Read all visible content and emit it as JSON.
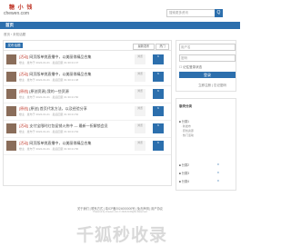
{
  "header": {
    "logo_cn": "糖 小 钱",
    "logo_en": "chewen.com",
    "search_placeholder": "搜索更多资讯",
    "search_btn": "Q"
  },
  "nav": {
    "home": "首页"
  },
  "breadcrumb": "首页 › 未知话题",
  "main": {
    "post_button": "发布话题",
    "sort_latest": "最新发布",
    "sort_hot": "热门",
    "rows": [
      {
        "tag": "[活动]",
        "title": "网页版单挑直播中，以美丽俏精品合集",
        "meta": "楼主 · 发布于 2024-01-01 · 最后回复 01:30:21:47",
        "views": "浏览",
        "replies": "6"
      },
      {
        "tag": "[活动]",
        "title": "网页版单挑直播中，以美丽俏精品合集",
        "meta": "楼主 · 发布于 2024-01-01 · 最后回复 01:30:21:48",
        "views": "浏览",
        "replies": "6"
      },
      {
        "tag": "[原创]",
        "title": "[原创资源] 我的一些资源",
        "meta": "楼主 · 发布于 2024-01-01 · 最后回复 01:30:21:50",
        "views": "浏览",
        "replies": "6"
      },
      {
        "tag": "[原创]",
        "title": "[原创] 首页代发方法，以及经验分享",
        "meta": "楼主 · 发布于 2024-01-01 · 最后回复 01:30:21:52",
        "views": "浏览",
        "replies": "6"
      },
      {
        "tag": "[活动]",
        "title": "支付宝限时红包促销火热中 — 最新一折解锁会员",
        "meta": "楼主 · 发布于 2024-01-01 · 最后回复 01:30:21:54",
        "views": "浏览",
        "replies": "6"
      },
      {
        "tag": "[活动]",
        "title": "网页版单挑直播中，以美丽俏精品合集",
        "meta": "楼主 · 发布于 2024-01-01 · 最后回复 01:30:21:56",
        "views": "浏览",
        "replies": "6"
      }
    ]
  },
  "sidebar": {
    "username_placeholder": "用户名",
    "password_placeholder": "密码",
    "remember": "☐ 记住登录状态",
    "login": "登录",
    "register": "立即注册 | 忘记密码",
    "categories_title": "版块分类",
    "cat1": "■ 分类1",
    "cat1_sub1": "· 新发布",
    "cat1_sub2": "· 原创资源",
    "cat1_sub3": "· 热门活动",
    "cat2": "■ 分类2",
    "cat2_count": "0",
    "cat3": "■ 分类3",
    "cat3_count": "0",
    "cat4": "■ 分类4",
    "cat4_count": "0"
  },
  "footer": {
    "links": "关于我们 | 联系方式 | 粤ICP备2024000000号 | 免责声明 | 用户协议",
    "copy": "Powered by chewen.com © 2024 All Rights Reserved"
  },
  "watermark": "千狐秒收录"
}
